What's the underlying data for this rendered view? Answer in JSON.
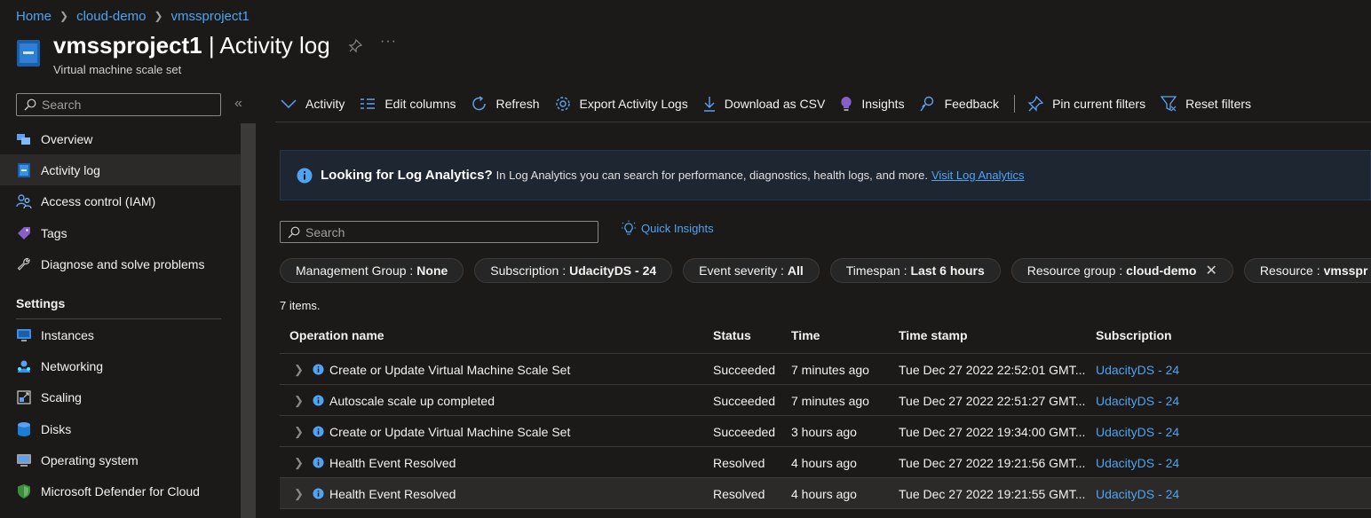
{
  "breadcrumb": [
    "Home",
    "cloud-demo",
    "vmssproject1"
  ],
  "header": {
    "resource_name": "vmssproject1",
    "page_name": "| Activity log",
    "subtitle": "Virtual machine scale set"
  },
  "sidebar": {
    "search_placeholder": "Search",
    "items": [
      {
        "label": "Overview",
        "icon": "overview-icon"
      },
      {
        "label": "Activity log",
        "icon": "activity-log-icon",
        "active": true
      },
      {
        "label": "Access control (IAM)",
        "icon": "people-icon"
      },
      {
        "label": "Tags",
        "icon": "tag-icon"
      },
      {
        "label": "Diagnose and solve problems",
        "icon": "wrench-icon"
      }
    ],
    "settings_header": "Settings",
    "settings_items": [
      {
        "label": "Instances",
        "icon": "monitor-icon"
      },
      {
        "label": "Networking",
        "icon": "network-icon"
      },
      {
        "label": "Scaling",
        "icon": "scaling-icon"
      },
      {
        "label": "Disks",
        "icon": "disk-icon"
      },
      {
        "label": "Operating system",
        "icon": "os-icon"
      },
      {
        "label": "Microsoft Defender for Cloud",
        "icon": "shield-icon"
      }
    ]
  },
  "toolbar": {
    "activity": "Activity",
    "edit_columns": "Edit columns",
    "refresh": "Refresh",
    "export": "Export Activity Logs",
    "download": "Download as CSV",
    "insights": "Insights",
    "feedback": "Feedback",
    "pin_filters": "Pin current filters",
    "reset_filters": "Reset filters"
  },
  "banner": {
    "heading": "Looking for Log Analytics?",
    "text": "In Log Analytics you can search for performance, diagnostics, health logs, and more.",
    "link": "Visit Log Analytics"
  },
  "search": {
    "placeholder": "Search"
  },
  "quick_insights": "Quick Insights",
  "filters": [
    {
      "key": "Management Group :",
      "value": "None"
    },
    {
      "key": "Subscription :",
      "value": "UdacityDS - 24"
    },
    {
      "key": "Event severity :",
      "value": "All"
    },
    {
      "key": "Timespan :",
      "value": "Last 6 hours"
    },
    {
      "key": "Resource group :",
      "value": "cloud-demo",
      "removable": true
    },
    {
      "key": "Resource :",
      "value": "vmsspr"
    }
  ],
  "item_count": "7 items.",
  "table": {
    "columns": [
      "Operation name",
      "Status",
      "Time",
      "Time stamp",
      "Subscription"
    ],
    "rows": [
      {
        "operation": "Create or Update Virtual Machine Scale Set",
        "status": "Succeeded",
        "time": "7 minutes ago",
        "timestamp": "Tue Dec 27 2022 22:52:01 GMT...",
        "subscription": "UdacityDS - 24"
      },
      {
        "operation": "Autoscale scale up completed",
        "status": "Succeeded",
        "time": "7 minutes ago",
        "timestamp": "Tue Dec 27 2022 22:51:27 GMT...",
        "subscription": "UdacityDS - 24"
      },
      {
        "operation": "Create or Update Virtual Machine Scale Set",
        "status": "Succeeded",
        "time": "3 hours ago",
        "timestamp": "Tue Dec 27 2022 19:34:00 GMT...",
        "subscription": "UdacityDS - 24"
      },
      {
        "operation": "Health Event Resolved",
        "status": "Resolved",
        "time": "4 hours ago",
        "timestamp": "Tue Dec 27 2022 19:21:56 GMT...",
        "subscription": "UdacityDS - 24"
      },
      {
        "operation": "Health Event Resolved",
        "status": "Resolved",
        "time": "4 hours ago",
        "timestamp": "Tue Dec 27 2022 19:21:55 GMT...",
        "subscription": "UdacityDS - 24"
      }
    ]
  },
  "colors": {
    "accent": "#4fa3f0",
    "background": "#1b1a19"
  }
}
